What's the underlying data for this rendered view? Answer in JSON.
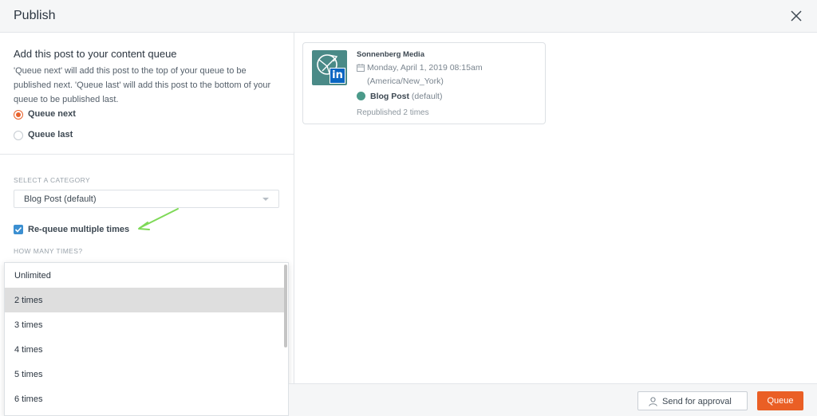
{
  "header": {
    "title": "Publish",
    "close_icon": "close-icon"
  },
  "queue": {
    "title": "Add this post to your content queue",
    "description": "'Queue next' will add this post to the top of your queue to be published next. 'Queue last' will add this post to the bottom of your queue to be published last.",
    "options": [
      {
        "label": "Queue next",
        "selected": true
      },
      {
        "label": "Queue last",
        "selected": false
      }
    ]
  },
  "category": {
    "section_label": "SELECT A CATEGORY",
    "selected_value": "Blog Post  (default)"
  },
  "requeue": {
    "label": "Re-queue multiple times",
    "checked": true,
    "how_many_label": "HOW MANY TIMES?",
    "options": [
      "Unlimited",
      "2 times",
      "3 times",
      "4 times",
      "5 times",
      "6 times"
    ],
    "highlighted": "2 times"
  },
  "preview": {
    "account_name": "Sonnenberg Media",
    "date": "Monday, April 1, 2019 08:15am",
    "timezone": "(America/New_York)",
    "category_name": "Blog Post",
    "category_suffix": "(default)",
    "republished": "Republished 2 times",
    "network_badge": "in",
    "category_color": "#4b9a8a"
  },
  "footer": {
    "send_for_approval": "Send for approval",
    "queue": "Queue"
  },
  "colors": {
    "accent": "#ea5f25",
    "checkbox": "#3b8fd1",
    "annotation_arrow": "#7ed957"
  }
}
